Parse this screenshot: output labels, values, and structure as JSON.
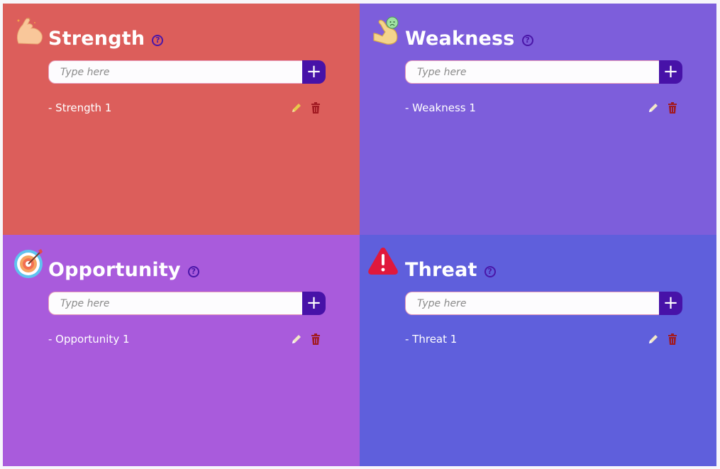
{
  "quadrants": {
    "strength": {
      "title": "Strength",
      "help_glyph": "?",
      "placeholder": "Type here",
      "add_glyph": "+",
      "icon": "flexed-biceps-icon",
      "items": [
        "- Strength 1"
      ],
      "color": "#dc5e5b",
      "edit_icon_color": "#e7c94b"
    },
    "weakness": {
      "title": "Weakness",
      "help_glyph": "?",
      "placeholder": "Type here",
      "add_glyph": "+",
      "icon": "sad-biceps-icon",
      "items": [
        "- Weakness 1"
      ],
      "color": "#7d5edb",
      "edit_icon_color": "#f2e7c8"
    },
    "opportunity": {
      "title": "Opportunity",
      "help_glyph": "?",
      "placeholder": "Type here",
      "add_glyph": "+",
      "icon": "target-icon",
      "items": [
        "- Opportunity 1"
      ],
      "color": "#a95bdc",
      "edit_icon_color": "#f2e7c8"
    },
    "threat": {
      "title": "Threat",
      "help_glyph": "?",
      "placeholder": "Type here",
      "add_glyph": "+",
      "icon": "warning-icon",
      "items": [
        "- Threat 1"
      ],
      "color": "#5f5fdc",
      "edit_icon_color": "#f2e7c8"
    }
  },
  "accent_color": "#4712a8",
  "delete_icon_color": "#a11a22"
}
